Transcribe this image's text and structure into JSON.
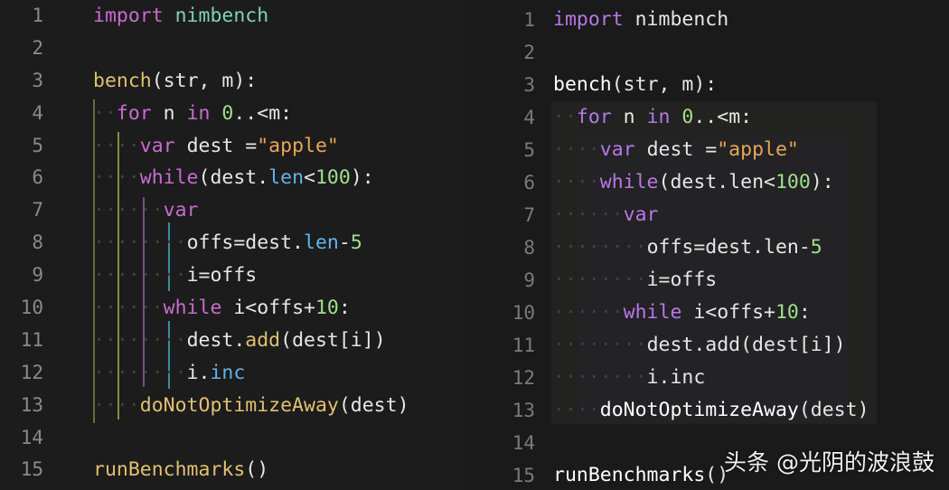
{
  "left_editor": {
    "lines": [
      {
        "n": "1",
        "indent": "",
        "tokens": [
          [
            "kw",
            "import "
          ],
          [
            "mod",
            "nimbench"
          ]
        ]
      },
      {
        "n": "2",
        "indent": "",
        "tokens": []
      },
      {
        "n": "3",
        "indent": "",
        "tokens": [
          [
            "fn",
            "bench"
          ],
          [
            "plain",
            "(str, m):"
          ]
        ]
      },
      {
        "n": "4",
        "indent": "  ",
        "tokens": [
          [
            "kw",
            "for "
          ],
          [
            "plain",
            "n "
          ],
          [
            "kw",
            "in "
          ],
          [
            "num",
            "0"
          ],
          [
            "plain",
            "..<m:"
          ]
        ]
      },
      {
        "n": "5",
        "indent": "    ",
        "tokens": [
          [
            "kw",
            "var "
          ],
          [
            "plain",
            "dest ="
          ],
          [
            "str",
            "\"apple\""
          ]
        ]
      },
      {
        "n": "6",
        "indent": "    ",
        "tokens": [
          [
            "kw",
            "while"
          ],
          [
            "plain",
            "(dest."
          ],
          [
            "prop",
            "len"
          ],
          [
            "plain",
            "<"
          ],
          [
            "num",
            "100"
          ],
          [
            "plain",
            "):"
          ]
        ]
      },
      {
        "n": "7",
        "indent": "      ",
        "tokens": [
          [
            "kw",
            "var"
          ]
        ]
      },
      {
        "n": "8",
        "indent": "        ",
        "tokens": [
          [
            "plain",
            "offs=dest."
          ],
          [
            "prop",
            "len"
          ],
          [
            "plain",
            "-"
          ],
          [
            "num",
            "5"
          ]
        ]
      },
      {
        "n": "9",
        "indent": "        ",
        "tokens": [
          [
            "plain",
            "i=offs"
          ]
        ]
      },
      {
        "n": "10",
        "indent": "      ",
        "tokens": [
          [
            "kw",
            "while "
          ],
          [
            "plain",
            "i<offs+"
          ],
          [
            "num",
            "10"
          ],
          [
            "plain",
            ":"
          ]
        ]
      },
      {
        "n": "11",
        "indent": "        ",
        "tokens": [
          [
            "plain",
            "dest."
          ],
          [
            "fn",
            "add"
          ],
          [
            "plain",
            "(dest[i])"
          ]
        ]
      },
      {
        "n": "12",
        "indent": "        ",
        "tokens": [
          [
            "plain",
            "i."
          ],
          [
            "prop",
            "inc"
          ]
        ]
      },
      {
        "n": "13",
        "indent": "    ",
        "tokens": [
          [
            "fn",
            "doNotOptimizeAway"
          ],
          [
            "plain",
            "(dest)"
          ]
        ]
      },
      {
        "n": "14",
        "indent": "",
        "tokens": []
      },
      {
        "n": "15",
        "indent": "",
        "tokens": [
          [
            "fn",
            "runBenchmarks"
          ],
          [
            "plain",
            "()"
          ]
        ]
      }
    ]
  },
  "right_editor": {
    "lines": [
      {
        "n": "1",
        "indent": "",
        "tokens": [
          [
            "kw",
            "import "
          ],
          [
            "mod",
            "nimbench"
          ]
        ]
      },
      {
        "n": "2",
        "indent": "",
        "tokens": []
      },
      {
        "n": "3",
        "indent": "",
        "tokens": [
          [
            "fn",
            "bench"
          ],
          [
            "plain",
            "(str, m):"
          ]
        ]
      },
      {
        "n": "4",
        "indent": "  ",
        "tokens": [
          [
            "kw",
            "for "
          ],
          [
            "plain",
            "n "
          ],
          [
            "kw",
            "in "
          ],
          [
            "num",
            "0"
          ],
          [
            "plain",
            "..<m:"
          ]
        ]
      },
      {
        "n": "5",
        "indent": "    ",
        "tokens": [
          [
            "kw",
            "var "
          ],
          [
            "plain",
            "dest ="
          ],
          [
            "str",
            "\"apple\""
          ]
        ]
      },
      {
        "n": "6",
        "indent": "    ",
        "tokens": [
          [
            "kw",
            "while"
          ],
          [
            "plain",
            "(dest.len<"
          ],
          [
            "num",
            "100"
          ],
          [
            "plain",
            "):"
          ]
        ]
      },
      {
        "n": "7",
        "indent": "      ",
        "tokens": [
          [
            "kw",
            "var"
          ]
        ]
      },
      {
        "n": "8",
        "indent": "        ",
        "tokens": [
          [
            "plain",
            "offs=dest.len-"
          ],
          [
            "num",
            "5"
          ]
        ]
      },
      {
        "n": "9",
        "indent": "        ",
        "tokens": [
          [
            "plain",
            "i=offs"
          ]
        ]
      },
      {
        "n": "10",
        "indent": "      ",
        "tokens": [
          [
            "kw",
            "while "
          ],
          [
            "plain",
            "i<offs+"
          ],
          [
            "num",
            "10"
          ],
          [
            "plain",
            ":"
          ]
        ]
      },
      {
        "n": "11",
        "indent": "        ",
        "tokens": [
          [
            "plain",
            "dest.add(dest[i])"
          ]
        ]
      },
      {
        "n": "12",
        "indent": "        ",
        "tokens": [
          [
            "plain",
            "i.inc"
          ]
        ]
      },
      {
        "n": "13",
        "indent": "    ",
        "tokens": [
          [
            "fn",
            "doNotOptimizeAway"
          ],
          [
            "plain",
            "(dest)"
          ]
        ]
      },
      {
        "n": "14",
        "indent": "",
        "tokens": []
      },
      {
        "n": "15",
        "indent": "",
        "tokens": [
          [
            "fn",
            "runBenchmarks"
          ],
          [
            "plain",
            "()"
          ]
        ]
      }
    ]
  },
  "watermark": {
    "text": "头条 @光阴的波浪鼓"
  },
  "colors": {
    "indent_guide_outer": "#c9c16a",
    "indent_guide_mid": "#8f5aa6",
    "indent_guide_inner": "#4aa6c4",
    "right_shade": "#25262a"
  }
}
